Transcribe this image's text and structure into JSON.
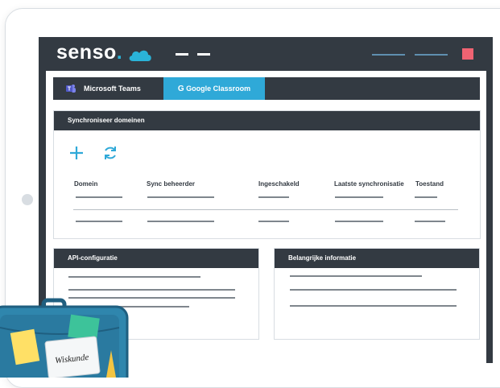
{
  "brand": {
    "name": "senso",
    "dot": ".",
    "accent": "#2ab3d8"
  },
  "colors": {
    "dark": "#333a42",
    "tab_active": "#2fa9d8",
    "window_control": "#f06372",
    "nav_line": "#5f8fb0"
  },
  "tabs": [
    {
      "label": "Microsoft Teams",
      "icon": "microsoft-teams-icon",
      "active": false
    },
    {
      "label": "Google Classroom",
      "icon": "google-g-icon",
      "glyph": "G",
      "active": true
    }
  ],
  "sync_panel": {
    "title": "Synchroniseer domeinen",
    "actions": [
      {
        "icon": "plus-icon"
      },
      {
        "icon": "refresh-icon"
      }
    ],
    "columns": [
      "Domein",
      "Sync beheerder",
      "Ingeschakeld",
      "Laatste synchronisatie",
      "Toestand"
    ]
  },
  "api_panel": {
    "title": "API-configuratie"
  },
  "info_panel": {
    "title": "Belangrijke informatie"
  },
  "illustration": {
    "label": "Wiskunde",
    "icon": "school-bag-icon"
  }
}
